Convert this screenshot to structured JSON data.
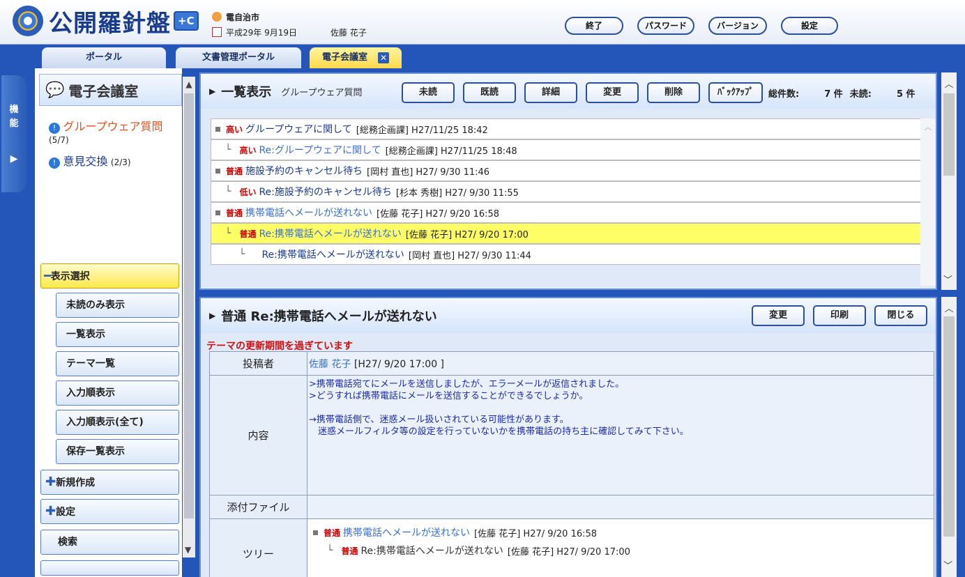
{
  "app": {
    "name": "公開羅針盤",
    "badge": "+C",
    "org": "電自治市",
    "date": "平成29年 9月19日",
    "user": "佐藤 花子"
  },
  "header_buttons": [
    "終了",
    "パスワード",
    "バージョン",
    "設定"
  ],
  "tabs": [
    {
      "label": "ポータル"
    },
    {
      "label": "文書管理ポータル"
    },
    {
      "label": "電子会議室"
    }
  ],
  "side": {
    "kino": "機能"
  },
  "left": {
    "title": "電子会議室",
    "rooms": [
      {
        "name": "グループウェア質問",
        "count": "(5/7)"
      },
      {
        "name": "意見交換",
        "count": "(2/3)"
      }
    ],
    "menu_display": "表示選択",
    "submenu": [
      "未読のみ表示",
      "一覧表示",
      "テーマ一覧",
      "入力順表示",
      "入力順表示(全て)",
      "保存一覧表示"
    ],
    "menu_new": "新規作成",
    "menu_settings": "設定",
    "menu_search": "検索"
  },
  "list": {
    "title": "一覧表示",
    "room": "グループウェア質問",
    "buttons": [
      "未読",
      "既読",
      "詳細",
      "変更",
      "削除",
      "ﾊﾞｯｸｱｯﾌﾟ"
    ],
    "total_label": "総件数:",
    "total_value": "7 件",
    "unread_label": "未読:",
    "unread_value": "5 件",
    "rows": [
      {
        "priority": "高い",
        "subject": "グループウェアに関して",
        "meta": "[総務企画課] H27/11/25 18:42"
      },
      {
        "priority": "高い",
        "subject": "Re:グループウェアに関して",
        "meta": "[総務企画課] H27/11/25 18:48"
      },
      {
        "priority": "普通",
        "subject": "施設予約のキャンセル待ち",
        "meta": "[岡村 直也] H27/ 9/30 11:46"
      },
      {
        "priority": "低い",
        "subject": "Re:施設予約のキャンセル待ち",
        "meta": "[杉本 秀樹] H27/ 9/30 11:55"
      },
      {
        "priority": "普通",
        "subject": "携帯電話へメールが送れない",
        "meta": "[佐藤 花子] H27/ 9/20 16:58"
      },
      {
        "priority": "普通",
        "subject": "Re:携帯電話へメールが送れない",
        "meta": "[佐藤 花子] H27/ 9/20 17:00"
      },
      {
        "priority": "",
        "subject": "Re:携帯電話へメールが送れない",
        "meta": "[岡村 直也] H27/ 9/30 11:44"
      }
    ]
  },
  "detail": {
    "title": "普通 Re:携帯電話へメールが送れない",
    "buttons": [
      "変更",
      "印刷",
      "閉じる"
    ],
    "warning": "テーマの更新期間を過ぎています",
    "poster_label": "投稿者",
    "poster_name": "佐藤 花子",
    "poster_meta": "[H27/ 9/20 17:00 ]",
    "content_label": "内容",
    "content_lines": [
      ">携帯電話宛てにメールを送信しましたが、エラーメールが返信されました。",
      ">どうすれば携帯電話にメールを送信することができるでしょうか。",
      "",
      "→携帯電話側で、迷惑メール扱いされている可能性があります。",
      "　迷惑メールフィルタ等の設定を行っていないかを携帯電話の持ち主に確認してみて下さい。"
    ],
    "attach_label": "添付ファイル",
    "tree_label": "ツリー",
    "tree": [
      {
        "priority": "普通",
        "subject": "携帯電話へメールが送れない",
        "meta": "[佐藤 花子] H27/ 9/20 16:58"
      },
      {
        "priority": "普通",
        "subject": "Re:携帯電話へメールが送れない",
        "meta": "[佐藤 花子] H27/ 9/20 17:00"
      }
    ]
  },
  "colors": {
    "accent": "#2356b8",
    "highlight": "#ffff66",
    "priority": "#cc0000"
  }
}
